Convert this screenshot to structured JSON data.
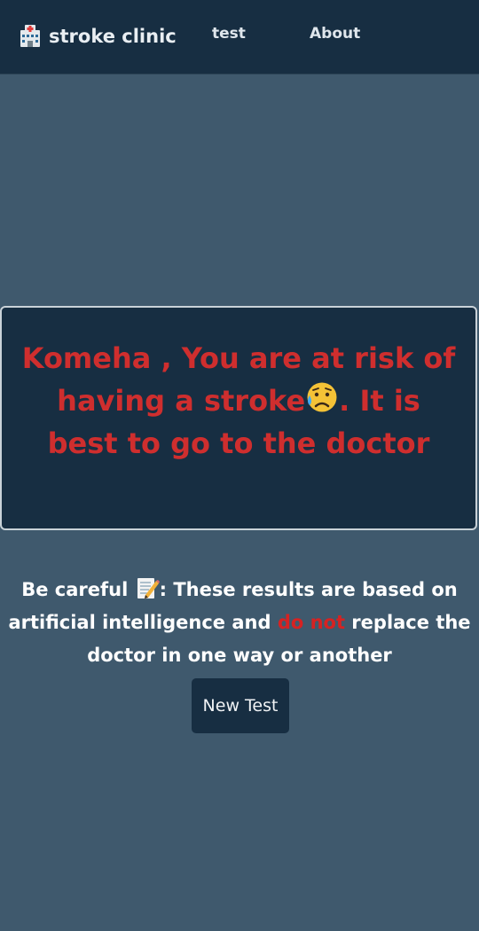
{
  "nav": {
    "brand_label": "stroke clinic",
    "brand_icon": "hospital-icon",
    "links": [
      {
        "label": "test"
      },
      {
        "label": "About"
      }
    ]
  },
  "result": {
    "before_emoji": "Komeha , You are at risk of having a stroke",
    "emoji_icon": "sad-face-icon",
    "after_emoji": ". It is best to go to the doctor",
    "text_color": "#cf2e2e"
  },
  "warning": {
    "lead": "Be careful",
    "memo_icon": "memo-icon",
    "middle": ": These results are based on artificial intelligence and ",
    "emphasis": "do not",
    "trailing": " replace the doctor in one way or another",
    "emphasis_color": "#d62222"
  },
  "actions": {
    "new_test_label": "New Test"
  },
  "colors": {
    "navbar_background": "#172e42",
    "page_background": "#3f596d"
  }
}
